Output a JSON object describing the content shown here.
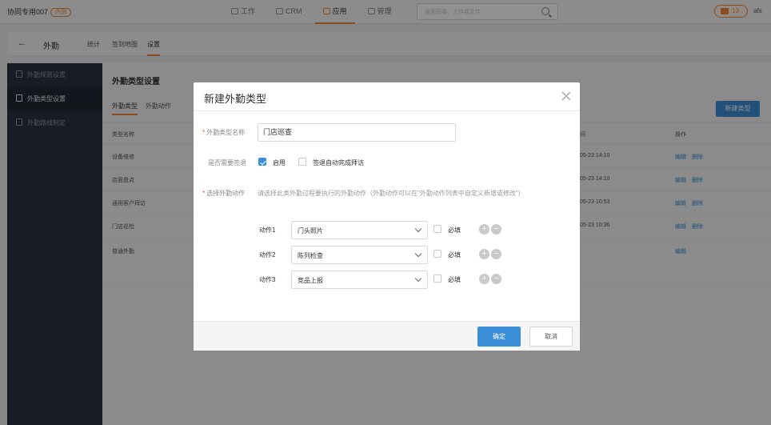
{
  "topbar": {
    "brand": "协同专用007",
    "brand_badge": "内测",
    "nav": [
      "工作",
      "CRM",
      "应用",
      "管理"
    ],
    "active_nav": "应用",
    "search_placeholder": "搜索同事、工作或文件",
    "message_count": "13",
    "user": "afs"
  },
  "subheader": {
    "back": "←",
    "title": "外勤",
    "tabs": [
      "统计",
      "签到地图",
      "设置"
    ],
    "active_tab": "设置"
  },
  "sidebar": {
    "items": [
      {
        "label": "外勤规则设置",
        "icon": "rules-icon"
      },
      {
        "label": "外勤类型设置",
        "icon": "type-icon"
      },
      {
        "label": "外勤路线制定",
        "icon": "route-icon"
      }
    ],
    "active": "外勤类型设置"
  },
  "main": {
    "title": "外勤类型设置",
    "tabs": [
      "外勤类型",
      "外勤动作"
    ],
    "new_button": "新建类型",
    "columns": {
      "name": "类型名称",
      "time": "间",
      "actions": "操作"
    },
    "rows": [
      {
        "name": "设备维修",
        "time": "05-23 14:10",
        "edit": "编辑",
        "delete": "删除"
      },
      {
        "name": "店面盘点",
        "time": "05-23 14:10",
        "edit": "编辑",
        "delete": "删除"
      },
      {
        "name": "通用客户拜访",
        "time": "05-23 10:53",
        "edit": "编辑",
        "delete": "删除"
      },
      {
        "name": "门店巡检",
        "time": "05-23 10:36",
        "edit": "编辑",
        "delete": "删除"
      },
      {
        "name": "普通外勤",
        "time": "",
        "edit": "编辑",
        "delete": ""
      }
    ]
  },
  "modal": {
    "title": "新建外勤类型",
    "name_label": "外勤类型名称",
    "name_value": "门店巡查",
    "signout_label": "是否需要签退",
    "enable_label": "启用",
    "enable_checked": true,
    "auto_label": "签退自动完成拜访",
    "auto_checked": false,
    "action_label": "选择外勤动作",
    "action_hint": "请选择此类外勤过程要执行的外勤动作（外勤动作可以在\"外勤动作列表中自定义新增或修改\"）",
    "required_label": "必填",
    "actions": [
      {
        "label": "动作1",
        "value": "门头照片",
        "required": false
      },
      {
        "label": "动作2",
        "value": "陈列检查",
        "required": false
      },
      {
        "label": "动作3",
        "value": "竞品上报",
        "required": false
      }
    ],
    "ok": "确定",
    "cancel": "取消"
  },
  "colors": {
    "accent": "#f08a3c",
    "primary": "#3b8fd9",
    "sidebar": "#2e3242",
    "required": "#e8493e"
  }
}
